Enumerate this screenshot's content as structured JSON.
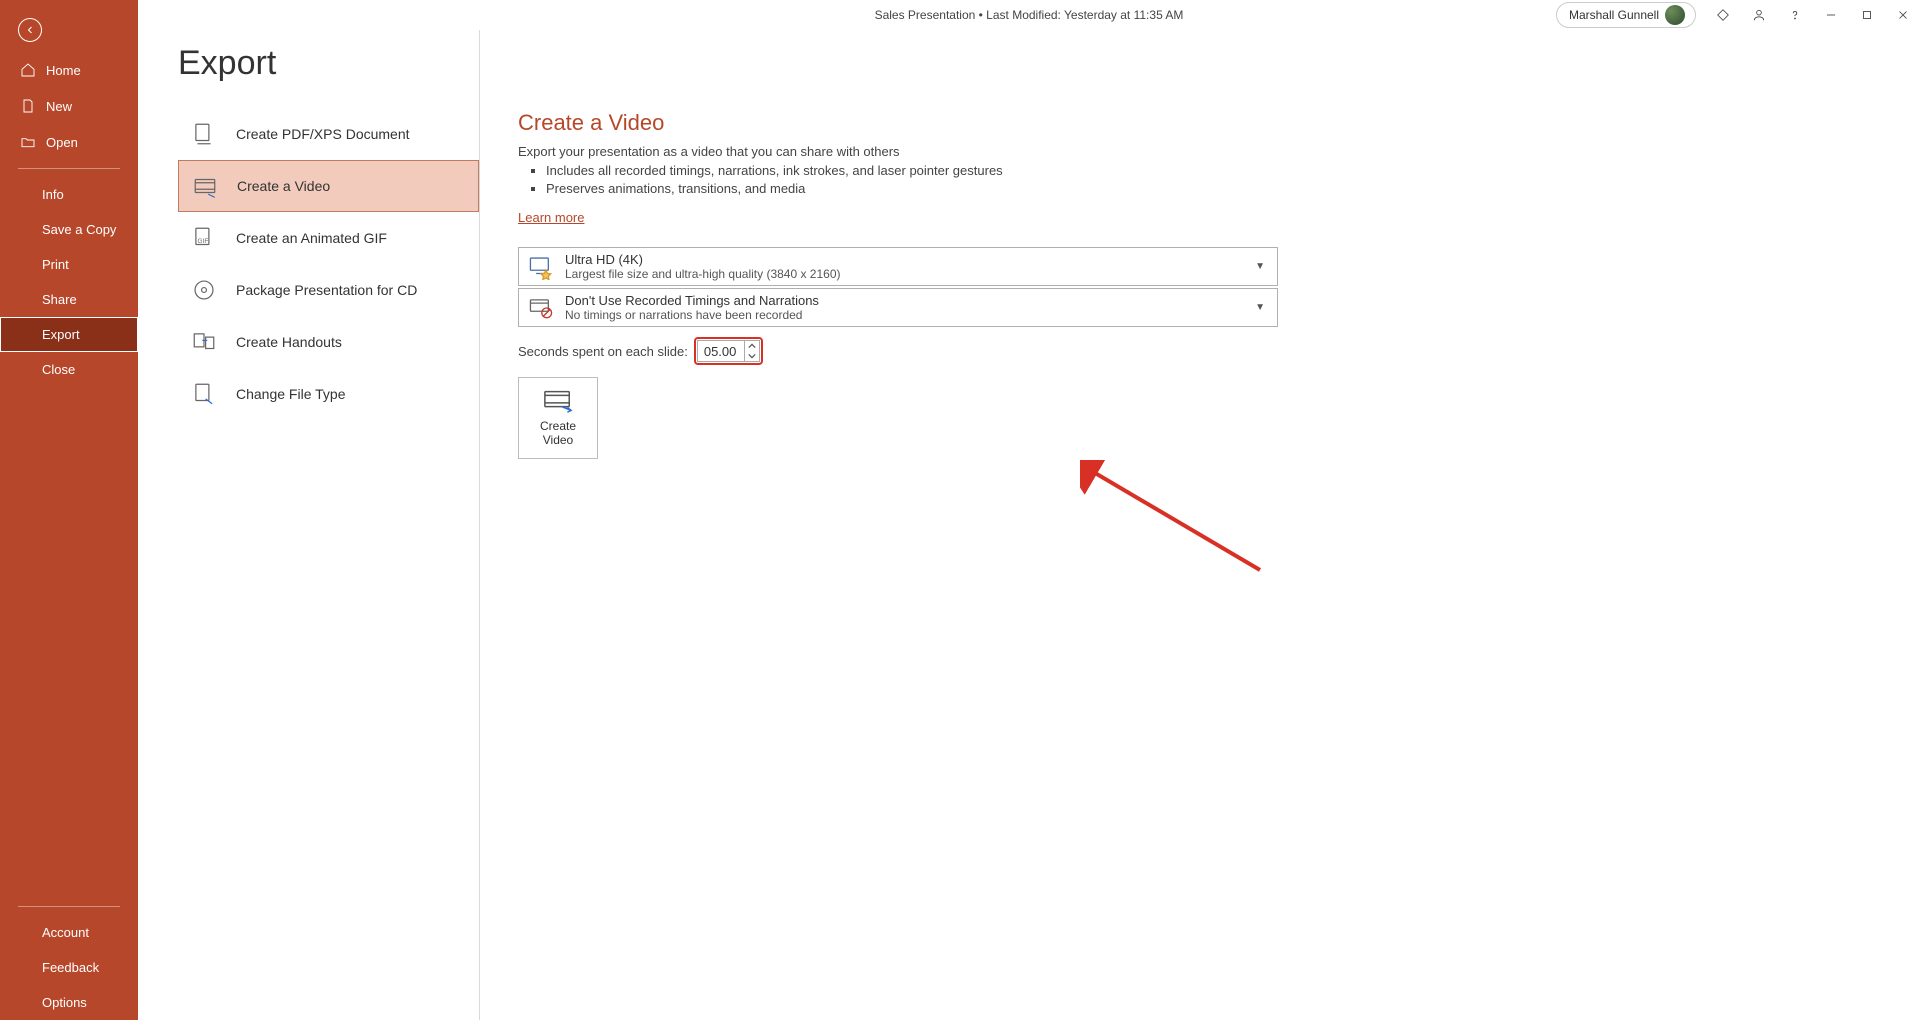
{
  "title_bar": {
    "document_title": "Sales Presentation • Last Modified: Yesterday at 11:35 AM",
    "user_name": "Marshall Gunnell"
  },
  "sidebar": {
    "home": "Home",
    "new": "New",
    "open": "Open",
    "info": "Info",
    "save_a_copy": "Save a Copy",
    "print": "Print",
    "share": "Share",
    "export": "Export",
    "close": "Close",
    "account": "Account",
    "feedback": "Feedback",
    "options": "Options"
  },
  "page": {
    "title": "Export"
  },
  "export_options": {
    "pdf": "Create PDF/XPS Document",
    "video": "Create a Video",
    "gif": "Create an Animated GIF",
    "package_cd": "Package Presentation for CD",
    "handouts": "Create Handouts",
    "change_file_type": "Change File Type"
  },
  "detail": {
    "heading": "Create a Video",
    "subtitle": "Export your presentation as a video that you can share with others",
    "bullets": [
      "Includes all recorded timings, narrations, ink strokes, and laser pointer gestures",
      "Preserves animations, transitions, and media"
    ],
    "learn_more": "Learn more",
    "quality": {
      "title": "Ultra HD (4K)",
      "desc": "Largest file size and ultra-high quality (3840 x 2160)"
    },
    "timings": {
      "title": "Don't Use Recorded Timings and Narrations",
      "desc": "No timings or narrations have been recorded"
    },
    "seconds_label": "Seconds spent on each slide:",
    "seconds_value": "05.00",
    "create_video_btn": "Create\nVideo"
  }
}
